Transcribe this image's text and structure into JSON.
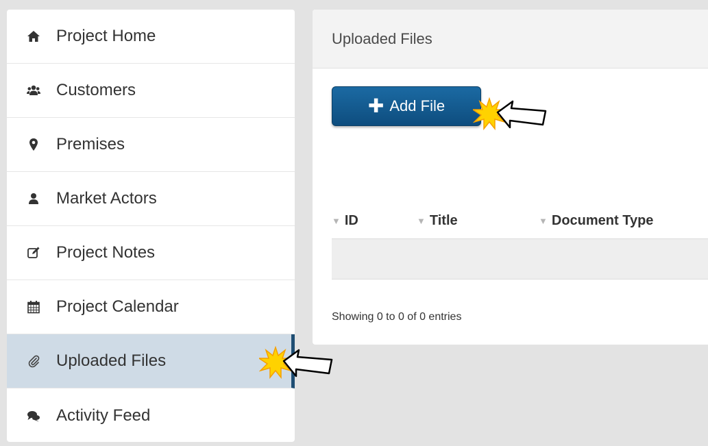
{
  "sidebar": {
    "items": [
      {
        "label": "Project Home",
        "icon": "home-icon"
      },
      {
        "label": "Customers",
        "icon": "users-icon"
      },
      {
        "label": "Premises",
        "icon": "map-marker-icon"
      },
      {
        "label": "Market Actors",
        "icon": "user-icon"
      },
      {
        "label": "Project Notes",
        "icon": "edit-icon"
      },
      {
        "label": "Project Calendar",
        "icon": "calendar-icon"
      },
      {
        "label": "Uploaded Files",
        "icon": "paperclip-icon",
        "active": true
      },
      {
        "label": "Activity Feed",
        "icon": "comments-icon"
      }
    ]
  },
  "panel": {
    "title": "Uploaded Files",
    "add_button": "Add File",
    "columns": [
      "ID",
      "Title",
      "Document Type"
    ],
    "rows": [],
    "info": "Showing 0 to 0 of 0 entries"
  },
  "colors": {
    "accent": "#1f4e73",
    "button": "#165d92",
    "active_bg": "#cfdbe6"
  }
}
